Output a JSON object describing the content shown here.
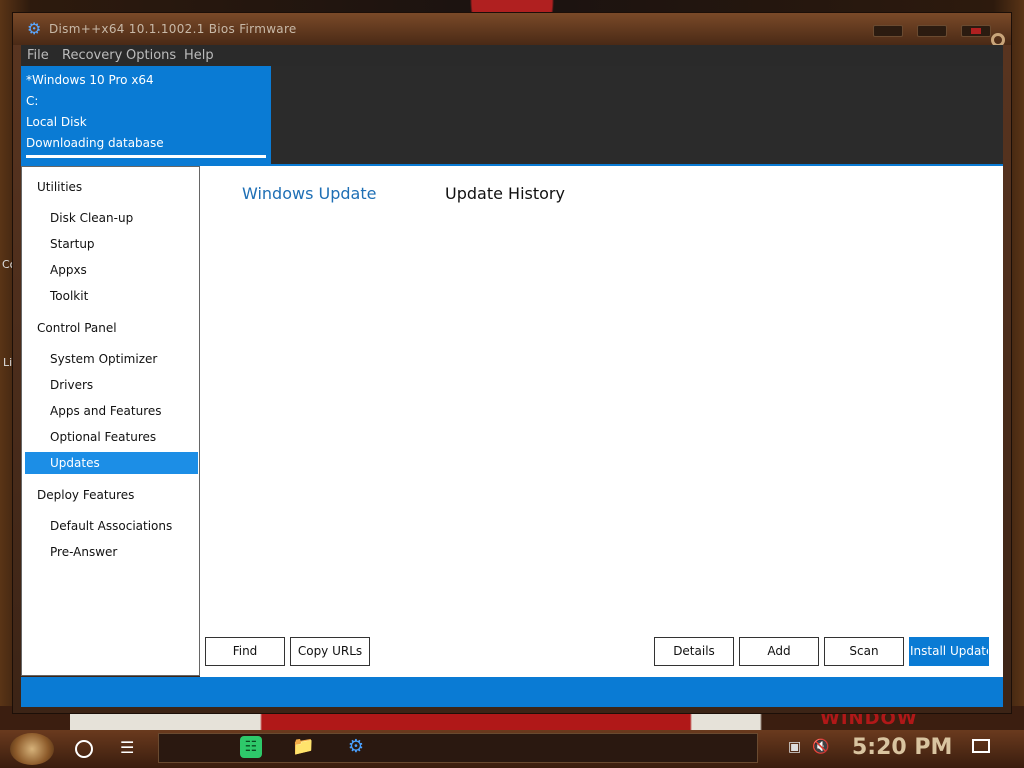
{
  "window": {
    "title": "Dism++x64 10.1.1002.1 Bios Firmware"
  },
  "menu": [
    "File",
    "Recovery",
    "Options",
    "Help"
  ],
  "image_card": {
    "os": "*Windows 10 Pro x64",
    "drive": "C:",
    "disk": "Local Disk",
    "status": "Downloading database"
  },
  "sidebar": {
    "sections": [
      {
        "title": "Utilities",
        "items": [
          "Disk Clean-up",
          "Startup",
          "Appxs",
          "Toolkit"
        ]
      },
      {
        "title": "Control Panel",
        "items": [
          "System Optimizer",
          "Drivers",
          "Apps and Features",
          "Optional Features",
          "Updates"
        ]
      },
      {
        "title": "Deploy Features",
        "items": [
          "Default Associations",
          "Pre-Answer"
        ]
      }
    ],
    "active": "Updates"
  },
  "tabs": {
    "windows_update": "Windows Update",
    "update_history": "Update History"
  },
  "buttons": {
    "find": "Find",
    "copy_urls": "Copy URLs",
    "details": "Details",
    "add": "Add",
    "scan": "Scan",
    "install_update": "Install Update"
  },
  "taskbar": {
    "clock": "5:20 PM"
  },
  "desktop": {
    "left_text_1": "Co",
    "left_text_2": "Li",
    "promo": "WINDOW"
  },
  "colors": {
    "accent": "#0a7bd4",
    "selected": "#1c8ee6",
    "tab_active": "#1e6fb5"
  }
}
